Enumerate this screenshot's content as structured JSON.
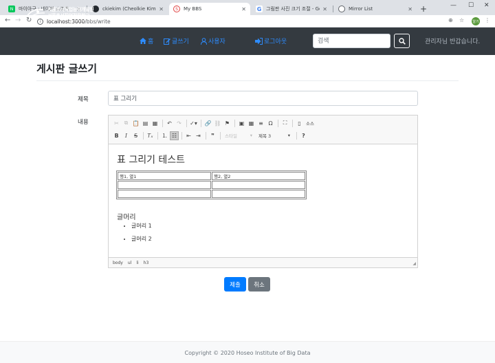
{
  "browser": {
    "tabs": [
      {
        "title": "마이아구 : 네이버 스포츠",
        "icon": "naver-icon",
        "color": "#03c75a",
        "glyph": "N"
      },
      {
        "title": "ckiekim (Cheolkie Kim)",
        "icon": "github-icon",
        "color": "#24292e",
        "glyph": ""
      },
      {
        "title": "My BBS",
        "icon": "bbs-favicon",
        "color": "#e04040",
        "glyph": "S"
      },
      {
        "title": "그림판 사진 크기 조절 - Google",
        "icon": "google-icon",
        "color": "#4285f4",
        "glyph": "G"
      },
      {
        "title": "Mirror List",
        "icon": "globe-icon",
        "color": "#5f6368",
        "glyph": ""
      }
    ],
    "url_host": "localhost:3000",
    "url_path": "/bbs/write",
    "profile_label": "알기"
  },
  "navbar": {
    "logo_line1": "서울호서직업능력개발원",
    "logo_line2": "서울호서직업전문학교",
    "logo_line3": "SEOUL HOSEO VOCATIONAL TRAINING COLLEGE",
    "home": "홈",
    "write": "글쓰기",
    "users": "사용자",
    "logout": "로그아웃",
    "search_placeholder": "검색",
    "welcome": "관리자님 반갑습니다."
  },
  "page": {
    "title": "게시판 글쓰기",
    "title_label": "제목",
    "title_value": "표 그리기",
    "content_label": "내용",
    "submit": "제출",
    "cancel": "취소"
  },
  "editor": {
    "styles_combo": "스타일",
    "format_combo": "제목 3",
    "source_label": "소스",
    "heading": "표 그리기 테스트",
    "table": [
      [
        "행1, 열1",
        "행2, 열2"
      ],
      [
        "",
        ""
      ],
      [
        "",
        ""
      ]
    ],
    "subheading": "글머리",
    "list": [
      "글머리 1",
      "글머리 2"
    ],
    "path": [
      "body",
      "ul",
      "li",
      "h3"
    ]
  },
  "footer": {
    "copyright": "Copyright © 2020 Hoseo Institute of Big Data"
  },
  "colors": {
    "navbar": "#343a40",
    "link": "#2d8cff",
    "primary": "#007bff",
    "secondary": "#6c757d"
  }
}
